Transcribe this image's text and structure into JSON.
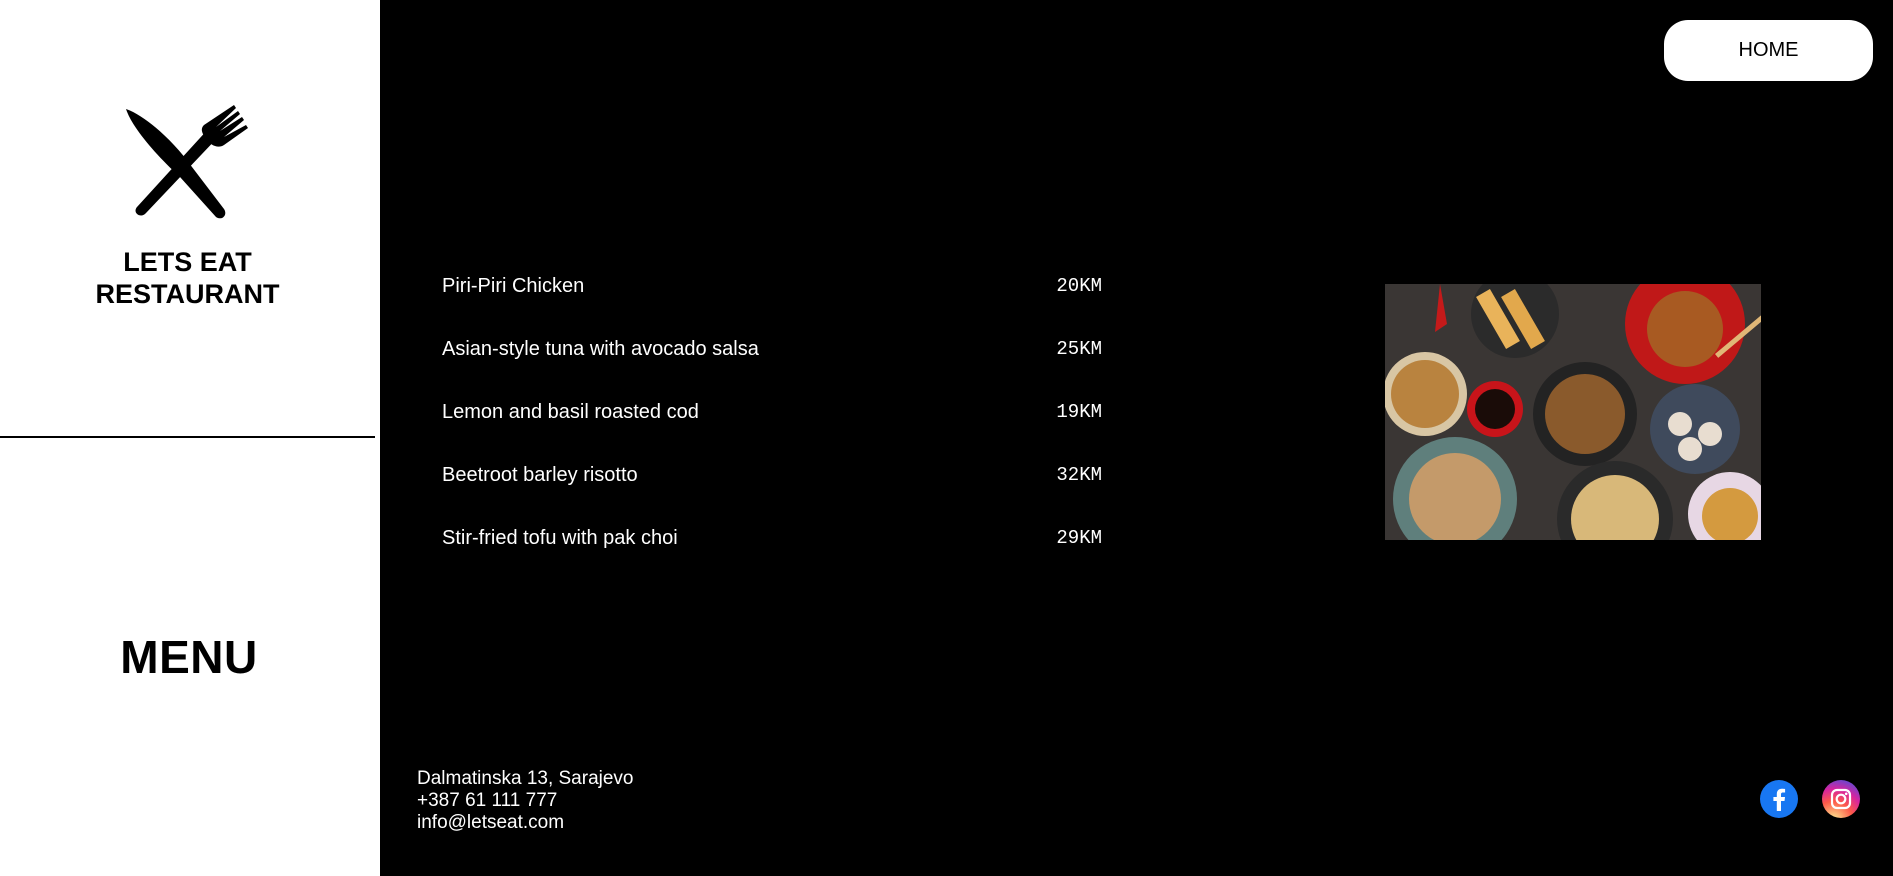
{
  "sidebar": {
    "logo_icon": "fork-knife-icon",
    "brand_line1": "LETS EAT",
    "brand_line2": "RESTAURANT",
    "menu_label": "MENU"
  },
  "header": {
    "home_label": "HOME"
  },
  "menu": {
    "items": [
      {
        "name": "Piri-Piri Chicken",
        "price": "20KM"
      },
      {
        "name": "Asian-style tuna with avocado salsa",
        "price": "25KM"
      },
      {
        "name": "Lemon and basil roasted cod",
        "price": "19KM"
      },
      {
        "name": "Beetroot barley risotto",
        "price": "32KM"
      },
      {
        "name": "Stir-fried tofu with pak choi",
        "price": "29KM"
      }
    ]
  },
  "image": {
    "subject": "food-platter-photo"
  },
  "footer": {
    "address": "Dalmatinska 13, Sarajevo",
    "phone": "+387 61 111 777",
    "email": "info@letseat.com",
    "social": [
      {
        "icon": "facebook-icon",
        "color": "#1877f2"
      },
      {
        "icon": "instagram-icon",
        "color": "#d6249f"
      }
    ]
  }
}
